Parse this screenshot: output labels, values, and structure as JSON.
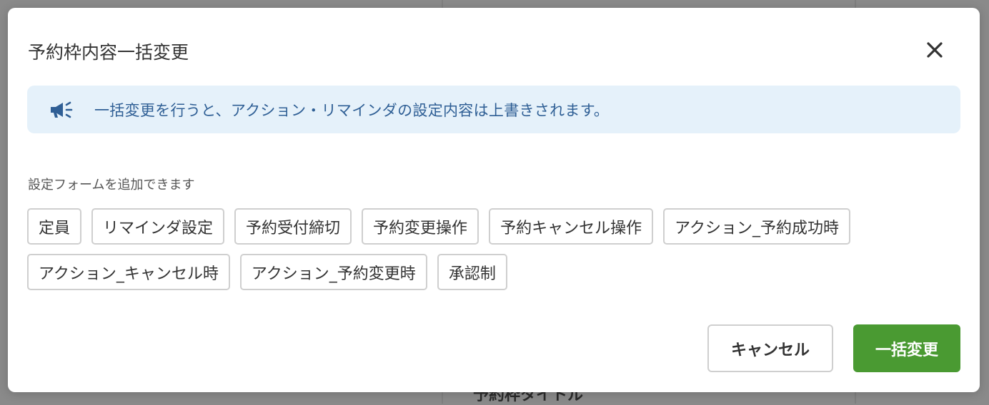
{
  "background": {
    "partial_heading": "予約枠タイトル"
  },
  "modal": {
    "title": "予約枠内容一括変更",
    "close_icon": "close-icon",
    "notice": {
      "icon": "megaphone-icon",
      "text": "一括変更を行うと、アクション・リマインダの設定内容は上書きされます。"
    },
    "section_label": "設定フォームを追加できます",
    "chips": [
      {
        "label": "定員"
      },
      {
        "label": "リマインダ設定"
      },
      {
        "label": "予約受付締切"
      },
      {
        "label": "予約変更操作"
      },
      {
        "label": "予約キャンセル操作"
      },
      {
        "label": "アクション_予約成功時"
      },
      {
        "label": "アクション_キャンセル時"
      },
      {
        "label": "アクション_予約変更時"
      },
      {
        "label": "承認制"
      }
    ],
    "buttons": {
      "cancel": "キャンセル",
      "submit": "一括変更"
    },
    "colors": {
      "primary": "#4a9a32",
      "notice_bg": "#e5f1fa",
      "notice_text": "#2f5f95"
    }
  }
}
